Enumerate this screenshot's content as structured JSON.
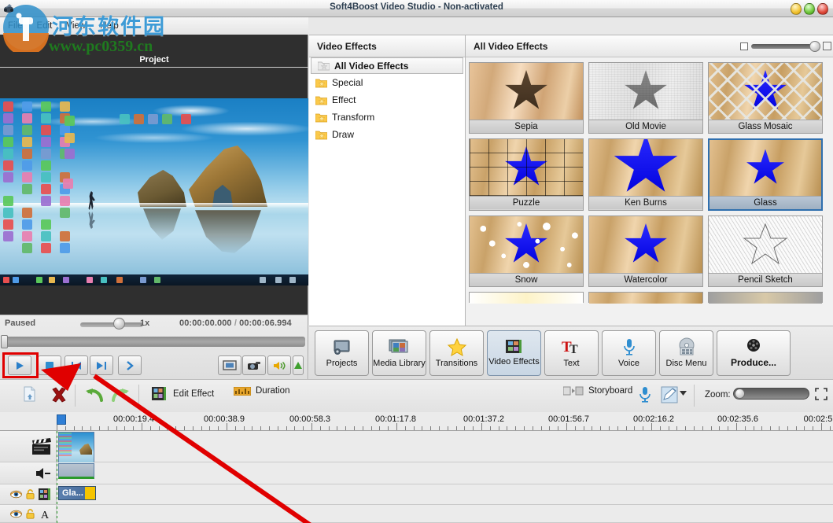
{
  "window": {
    "title": "Soft4Boost Video Studio - Non-activated",
    "app_icon": "app-icon",
    "controls": {
      "minimize": "minimize",
      "maximize": "maximize",
      "close": "close"
    }
  },
  "menu": {
    "items": [
      "File",
      "Edit",
      "View",
      "Help"
    ]
  },
  "watermark": {
    "cn": "河东软件园",
    "url": "www.pc0359.cn"
  },
  "preview": {
    "tab_label": "Project",
    "status": "Paused",
    "speed": "1x",
    "current_time": "00:00:00.000",
    "separator": "/",
    "total_time": "00:00:06.994",
    "buttons": [
      {
        "name": "play-button",
        "glyph": "▶"
      },
      {
        "name": "stop-button",
        "glyph": "■"
      },
      {
        "name": "previous-frame-button",
        "glyph": "|◀"
      },
      {
        "name": "next-frame-button",
        "glyph": "▶|"
      },
      {
        "name": "forward-button",
        "glyph": "❯"
      }
    ],
    "right_buttons": [
      {
        "name": "fullscreen-button",
        "glyph": "⛶"
      },
      {
        "name": "snapshot-button",
        "glyph": "◉"
      },
      {
        "name": "volume-button",
        "glyph": "🔊"
      },
      {
        "name": "volume-slider",
        "glyph": "▲"
      }
    ]
  },
  "effects": {
    "categories_header": "Video Effects",
    "categories": [
      {
        "label": "All Video Effects",
        "selected": true
      },
      {
        "label": "Special",
        "selected": false
      },
      {
        "label": "Effect",
        "selected": false
      },
      {
        "label": "Transform",
        "selected": false
      },
      {
        "label": "Draw",
        "selected": false
      }
    ],
    "grid_header": "All Video Effects",
    "items": [
      {
        "label": "Sepia",
        "selected": false,
        "style": "sepia"
      },
      {
        "label": "Old Movie",
        "selected": false,
        "style": "oldmovie"
      },
      {
        "label": "Glass Mosaic",
        "selected": false,
        "style": "mosaic"
      },
      {
        "label": "Puzzle",
        "selected": false,
        "style": "puzzle"
      },
      {
        "label": "Ken Burns",
        "selected": false,
        "style": "kenburns"
      },
      {
        "label": "Glass",
        "selected": true,
        "style": "glass"
      },
      {
        "label": "Snow",
        "selected": false,
        "style": "snow"
      },
      {
        "label": "Watercolor",
        "selected": false,
        "style": "watercolor"
      },
      {
        "label": "Pencil Sketch",
        "selected": false,
        "style": "pencil"
      }
    ]
  },
  "toolbar": {
    "buttons": [
      {
        "label": "Projects",
        "icon": "film-reel-icon",
        "selected": false
      },
      {
        "label": "Media Library",
        "icon": "media-stack-icon",
        "selected": false
      },
      {
        "label": "Transitions",
        "icon": "star-icon",
        "selected": false
      },
      {
        "label": "Video Effects",
        "icon": "filmstrip-icon",
        "selected": true
      },
      {
        "label": "Text",
        "icon": "text-tt-icon",
        "selected": false
      },
      {
        "label": "Voice",
        "icon": "microphone-icon",
        "selected": false
      },
      {
        "label": "Disc Menu",
        "icon": "disc-menu-icon",
        "selected": false
      },
      {
        "label": "Produce...",
        "icon": "film-disc-icon",
        "selected": false
      }
    ]
  },
  "timeline_toolbar": {
    "import_label": "",
    "delete_label": "",
    "undo_label": "",
    "redo_label": "",
    "edit_effect_label": "Edit Effect",
    "duration_label": "Duration",
    "storyboard_label": "Storyboard",
    "zoom_label": "Zoom:"
  },
  "ruler": {
    "labels": [
      "00:00:19.4",
      "00:00:38.9",
      "00:00:58.3",
      "00:01:17.8",
      "00:01:37.2",
      "00:01:56.7",
      "00:02:16.2",
      "00:02:35.6",
      "00:02:5"
    ]
  },
  "tracks": [
    {
      "name": "video-track",
      "icon": "clapperboard-icon",
      "clip": ""
    },
    {
      "name": "audio-track",
      "icon": "speaker-icon",
      "clip": ""
    },
    {
      "name": "effect-track",
      "icon": "filmstrip-icon",
      "clip": "Gla..."
    },
    {
      "name": "text-track",
      "icon": "letter-a-icon",
      "clip": ""
    }
  ],
  "colors": {
    "accent": "#2f6fae",
    "highlight_red": "#e00000",
    "selected_blue": "#2f7fd6",
    "watermark_blue": "#3d9bd6",
    "watermark_green": "#1f7a1f"
  }
}
